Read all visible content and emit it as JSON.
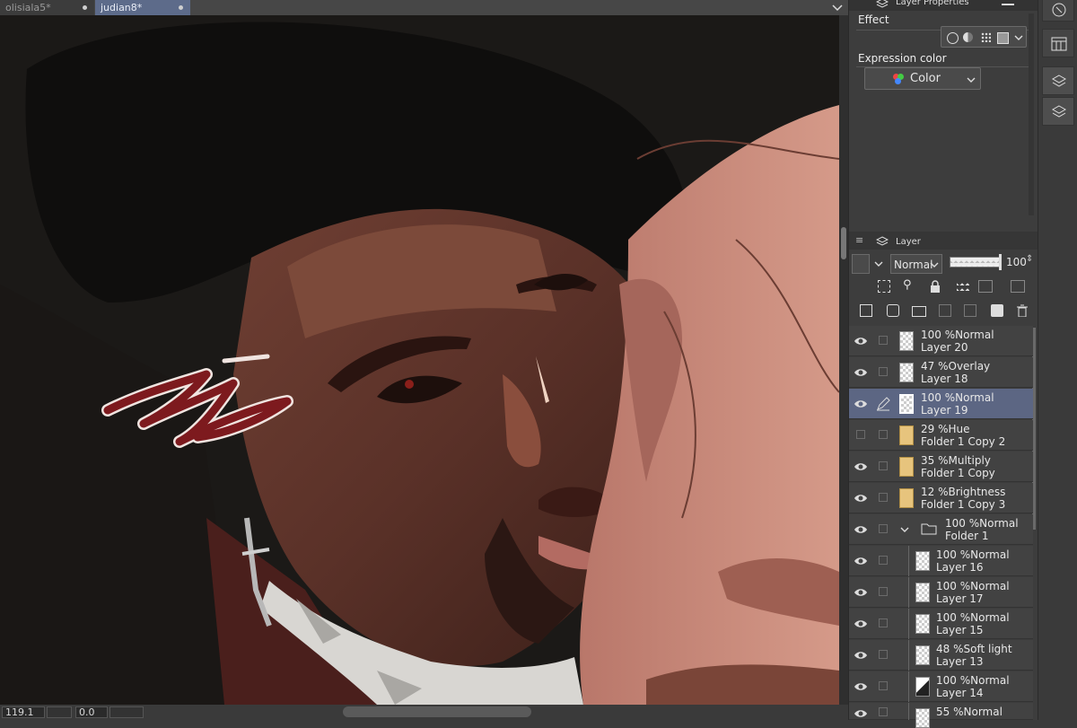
{
  "tabs": [
    {
      "label": "olisiala5*",
      "active": false
    },
    {
      "label": "judian8*",
      "active": true
    }
  ],
  "status": {
    "zoom": "119.1",
    "angle": "0.0"
  },
  "props": {
    "title": "Layer Properties",
    "effect_label": "Effect",
    "expression_label": "Expression color",
    "expression_value": "Color"
  },
  "layer_panel": {
    "title": "Layer",
    "blend_mode": "Normal",
    "opacity": "100"
  },
  "layers": [
    {
      "pct": "100 %",
      "mode": "Normal",
      "name": "Layer 20",
      "selected": false,
      "type": "raster",
      "indent": 0,
      "visible": true
    },
    {
      "pct": "47 %",
      "mode": "Overlay",
      "name": "Layer 18",
      "selected": false,
      "type": "raster",
      "indent": 0,
      "visible": true
    },
    {
      "pct": "100 %",
      "mode": "Normal",
      "name": "Layer 19",
      "selected": true,
      "type": "raster",
      "indent": 0,
      "visible": true
    },
    {
      "pct": "29 %",
      "mode": "Hue",
      "name": "Folder 1 Copy 2",
      "selected": false,
      "type": "foldercopy",
      "indent": 0,
      "visible": false
    },
    {
      "pct": "35 %",
      "mode": "Multiply",
      "name": "Folder 1 Copy",
      "selected": false,
      "type": "foldercopy",
      "indent": 0,
      "visible": true
    },
    {
      "pct": "12 %",
      "mode": "Brightness",
      "name": "Folder 1 Copy 3",
      "selected": false,
      "type": "foldercopy",
      "indent": 0,
      "visible": true
    },
    {
      "pct": "100 %",
      "mode": "Normal",
      "name": "Folder 1",
      "selected": false,
      "type": "folder",
      "indent": 0,
      "visible": true
    },
    {
      "pct": "100 %",
      "mode": "Normal",
      "name": "Layer 16",
      "selected": false,
      "type": "raster",
      "indent": 1,
      "visible": true
    },
    {
      "pct": "100 %",
      "mode": "Normal",
      "name": "Layer 17",
      "selected": false,
      "type": "raster",
      "indent": 1,
      "visible": true
    },
    {
      "pct": "100 %",
      "mode": "Normal",
      "name": "Layer 15",
      "selected": false,
      "type": "raster",
      "indent": 1,
      "visible": true
    },
    {
      "pct": "48 %",
      "mode": "Soft light",
      "name": "Layer 13",
      "selected": false,
      "type": "raster",
      "indent": 1,
      "visible": true
    },
    {
      "pct": "100 %",
      "mode": "Normal",
      "name": "Layer 14",
      "selected": false,
      "type": "raster",
      "indent": 1,
      "visible": true
    },
    {
      "pct": "55 %",
      "mode": "Normal",
      "name": "",
      "selected": false,
      "type": "raster",
      "indent": 1,
      "visible": true
    }
  ],
  "colors": {
    "accent": "#5c6683",
    "panel": "#3d3d3d",
    "canvas": "#1b1917"
  }
}
